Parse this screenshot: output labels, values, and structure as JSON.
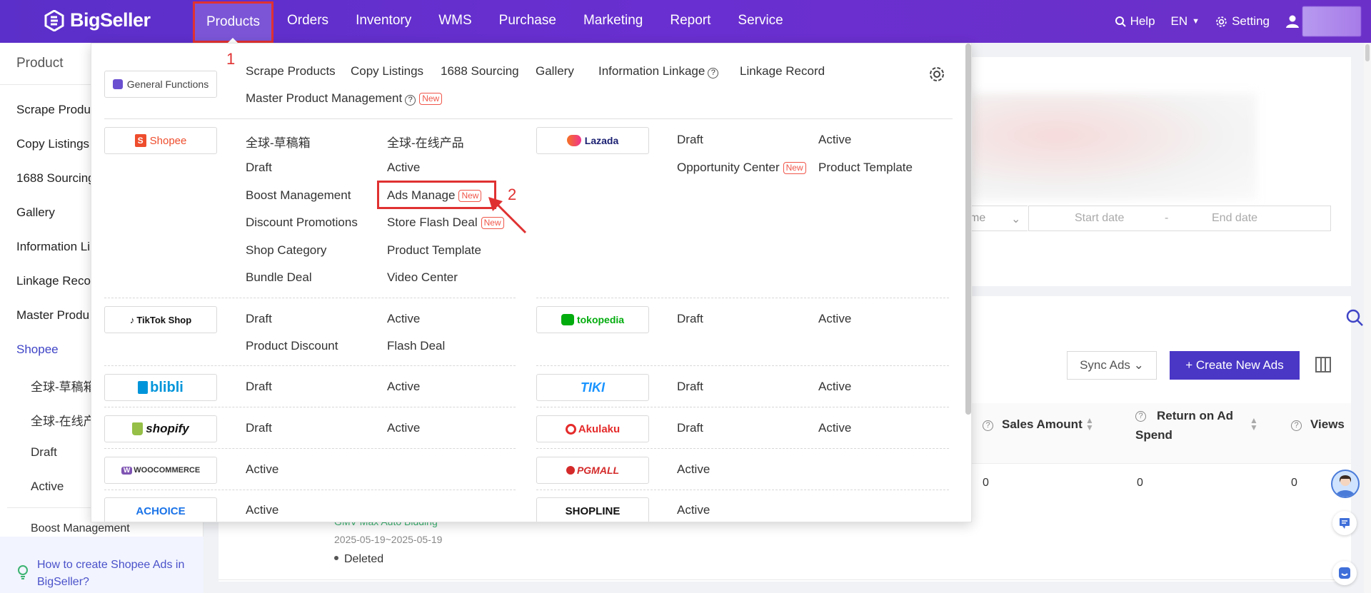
{
  "app": {
    "brand": "BigSeller"
  },
  "nav": {
    "items": [
      "Products",
      "Orders",
      "Inventory",
      "WMS",
      "Purchase",
      "Marketing",
      "Report",
      "Service"
    ],
    "help": "Help",
    "lang": "EN",
    "setting": "Setting"
  },
  "sidebar": {
    "title": "Product",
    "items": [
      "Scrape Produ",
      "Copy Listings",
      "1688 Sourcing",
      "Gallery",
      "Information Li",
      "Linkage Recor",
      "Master Produ",
      "Shopee"
    ],
    "subitems": [
      "全球-草稿箱",
      "全球-在线产",
      "Draft",
      "Active",
      "Boost Management"
    ],
    "help_text": "How to create Shopee Ads in BigSeller?"
  },
  "background": {
    "select_text": "me",
    "start_date": "Start date",
    "date_sep": "-",
    "end_date": "End date",
    "sync_ads": "Sync Ads",
    "create_ads": "+ Create New Ads",
    "col_sales": "Sales Amount",
    "col_roas_1": "Return on Ad",
    "col_roas_2": "Spend",
    "col_views": "Views",
    "val_sales": "0",
    "val_roas": "0",
    "val_views": "0",
    "row_bidding": "GMV Max Auto Bidding",
    "row_date": "2025-05-19~2025-05-19",
    "row_status": "Deleted"
  },
  "dropdown": {
    "general": {
      "label": "General Functions",
      "links": [
        "Scrape Products",
        "Copy Listings",
        "1688 Sourcing",
        "Gallery",
        "Information Linkage",
        "Linkage Record",
        "Master Product Management"
      ],
      "new_badge": "New"
    },
    "shopee": {
      "label": "Shopee",
      "col1": [
        "全球-草稿箱",
        "Draft",
        "Boost Management",
        "Discount Promotions",
        "Shop Category",
        "Bundle Deal"
      ],
      "col2": [
        "全球-在线产品",
        "Active",
        "Ads Manage",
        "Store Flash Deal",
        "Product Template",
        "Video Center"
      ]
    },
    "lazada": {
      "label": "Lazada",
      "col1": [
        "Draft",
        "Opportunity Center"
      ],
      "col2": [
        "Active",
        "Product Template"
      ]
    },
    "tiktok": {
      "label": "TikTok Shop",
      "col1": [
        "Draft",
        "Product Discount"
      ],
      "col2": [
        "Active",
        "Flash Deal"
      ]
    },
    "tokopedia": {
      "label": "tokopedia",
      "col1": [
        "Draft"
      ],
      "col2": [
        "Active"
      ]
    },
    "blibli": {
      "label": "blibli",
      "col1": [
        "Draft"
      ],
      "col2": [
        "Active"
      ]
    },
    "tiki": {
      "label": "TIKI",
      "col1": [
        "Draft"
      ],
      "col2": [
        "Active"
      ]
    },
    "shopify": {
      "label": "shopify",
      "col1": [
        "Draft"
      ],
      "col2": [
        "Active"
      ]
    },
    "akulaku": {
      "label": "Akulaku",
      "col1": [
        "Draft"
      ],
      "col2": [
        "Active"
      ]
    },
    "woo": {
      "label": "WOOCOMMERCE",
      "col1": [
        "Active"
      ]
    },
    "pgmall": {
      "label": "PGMALL",
      "col1": [
        "Active"
      ]
    },
    "achoice": {
      "label": "ACHOICE",
      "col1": [
        "Active"
      ]
    },
    "shopline": {
      "label": "SHOPLINE",
      "col1": [
        "Active"
      ]
    }
  },
  "annotations": {
    "step1": "1",
    "step2": "2"
  },
  "colors": {
    "brand_purple": "#5b2fc9",
    "accent_red": "#e03131",
    "link_blue": "#3f44c6"
  }
}
